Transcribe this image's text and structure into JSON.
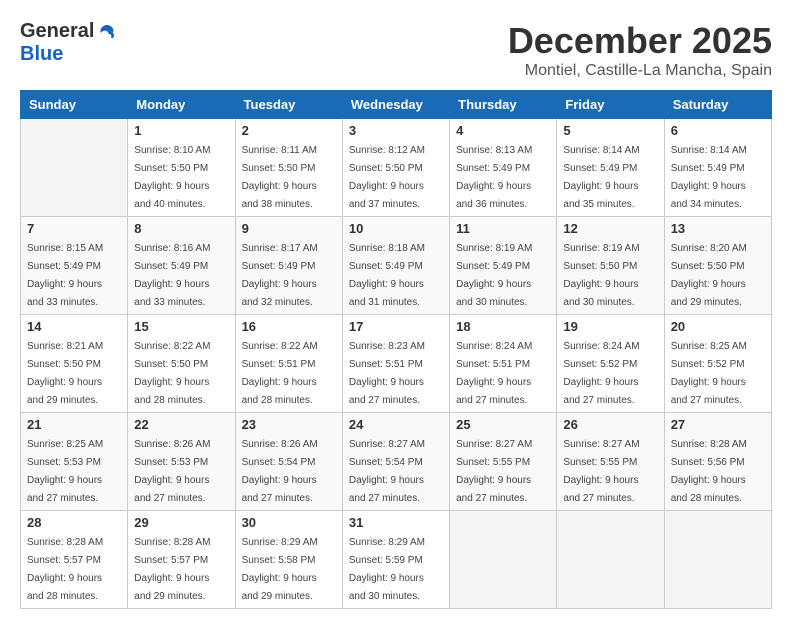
{
  "header": {
    "logo_general": "General",
    "logo_blue": "Blue",
    "month_year": "December 2025",
    "location": "Montiel, Castille-La Mancha, Spain"
  },
  "days_of_week": [
    "Sunday",
    "Monday",
    "Tuesday",
    "Wednesday",
    "Thursday",
    "Friday",
    "Saturday"
  ],
  "weeks": [
    [
      {
        "day": "",
        "sunrise": "",
        "sunset": "",
        "daylight": "",
        "empty": true
      },
      {
        "day": "1",
        "sunrise": "Sunrise: 8:10 AM",
        "sunset": "Sunset: 5:50 PM",
        "daylight": "Daylight: 9 hours and 40 minutes."
      },
      {
        "day": "2",
        "sunrise": "Sunrise: 8:11 AM",
        "sunset": "Sunset: 5:50 PM",
        "daylight": "Daylight: 9 hours and 38 minutes."
      },
      {
        "day": "3",
        "sunrise": "Sunrise: 8:12 AM",
        "sunset": "Sunset: 5:50 PM",
        "daylight": "Daylight: 9 hours and 37 minutes."
      },
      {
        "day": "4",
        "sunrise": "Sunrise: 8:13 AM",
        "sunset": "Sunset: 5:49 PM",
        "daylight": "Daylight: 9 hours and 36 minutes."
      },
      {
        "day": "5",
        "sunrise": "Sunrise: 8:14 AM",
        "sunset": "Sunset: 5:49 PM",
        "daylight": "Daylight: 9 hours and 35 minutes."
      },
      {
        "day": "6",
        "sunrise": "Sunrise: 8:14 AM",
        "sunset": "Sunset: 5:49 PM",
        "daylight": "Daylight: 9 hours and 34 minutes."
      }
    ],
    [
      {
        "day": "7",
        "sunrise": "Sunrise: 8:15 AM",
        "sunset": "Sunset: 5:49 PM",
        "daylight": "Daylight: 9 hours and 33 minutes."
      },
      {
        "day": "8",
        "sunrise": "Sunrise: 8:16 AM",
        "sunset": "Sunset: 5:49 PM",
        "daylight": "Daylight: 9 hours and 33 minutes."
      },
      {
        "day": "9",
        "sunrise": "Sunrise: 8:17 AM",
        "sunset": "Sunset: 5:49 PM",
        "daylight": "Daylight: 9 hours and 32 minutes."
      },
      {
        "day": "10",
        "sunrise": "Sunrise: 8:18 AM",
        "sunset": "Sunset: 5:49 PM",
        "daylight": "Daylight: 9 hours and 31 minutes."
      },
      {
        "day": "11",
        "sunrise": "Sunrise: 8:19 AM",
        "sunset": "Sunset: 5:49 PM",
        "daylight": "Daylight: 9 hours and 30 minutes."
      },
      {
        "day": "12",
        "sunrise": "Sunrise: 8:19 AM",
        "sunset": "Sunset: 5:50 PM",
        "daylight": "Daylight: 9 hours and 30 minutes."
      },
      {
        "day": "13",
        "sunrise": "Sunrise: 8:20 AM",
        "sunset": "Sunset: 5:50 PM",
        "daylight": "Daylight: 9 hours and 29 minutes."
      }
    ],
    [
      {
        "day": "14",
        "sunrise": "Sunrise: 8:21 AM",
        "sunset": "Sunset: 5:50 PM",
        "daylight": "Daylight: 9 hours and 29 minutes."
      },
      {
        "day": "15",
        "sunrise": "Sunrise: 8:22 AM",
        "sunset": "Sunset: 5:50 PM",
        "daylight": "Daylight: 9 hours and 28 minutes."
      },
      {
        "day": "16",
        "sunrise": "Sunrise: 8:22 AM",
        "sunset": "Sunset: 5:51 PM",
        "daylight": "Daylight: 9 hours and 28 minutes."
      },
      {
        "day": "17",
        "sunrise": "Sunrise: 8:23 AM",
        "sunset": "Sunset: 5:51 PM",
        "daylight": "Daylight: 9 hours and 27 minutes."
      },
      {
        "day": "18",
        "sunrise": "Sunrise: 8:24 AM",
        "sunset": "Sunset: 5:51 PM",
        "daylight": "Daylight: 9 hours and 27 minutes."
      },
      {
        "day": "19",
        "sunrise": "Sunrise: 8:24 AM",
        "sunset": "Sunset: 5:52 PM",
        "daylight": "Daylight: 9 hours and 27 minutes."
      },
      {
        "day": "20",
        "sunrise": "Sunrise: 8:25 AM",
        "sunset": "Sunset: 5:52 PM",
        "daylight": "Daylight: 9 hours and 27 minutes."
      }
    ],
    [
      {
        "day": "21",
        "sunrise": "Sunrise: 8:25 AM",
        "sunset": "Sunset: 5:53 PM",
        "daylight": "Daylight: 9 hours and 27 minutes."
      },
      {
        "day": "22",
        "sunrise": "Sunrise: 8:26 AM",
        "sunset": "Sunset: 5:53 PM",
        "daylight": "Daylight: 9 hours and 27 minutes."
      },
      {
        "day": "23",
        "sunrise": "Sunrise: 8:26 AM",
        "sunset": "Sunset: 5:54 PM",
        "daylight": "Daylight: 9 hours and 27 minutes."
      },
      {
        "day": "24",
        "sunrise": "Sunrise: 8:27 AM",
        "sunset": "Sunset: 5:54 PM",
        "daylight": "Daylight: 9 hours and 27 minutes."
      },
      {
        "day": "25",
        "sunrise": "Sunrise: 8:27 AM",
        "sunset": "Sunset: 5:55 PM",
        "daylight": "Daylight: 9 hours and 27 minutes."
      },
      {
        "day": "26",
        "sunrise": "Sunrise: 8:27 AM",
        "sunset": "Sunset: 5:55 PM",
        "daylight": "Daylight: 9 hours and 27 minutes."
      },
      {
        "day": "27",
        "sunrise": "Sunrise: 8:28 AM",
        "sunset": "Sunset: 5:56 PM",
        "daylight": "Daylight: 9 hours and 28 minutes."
      }
    ],
    [
      {
        "day": "28",
        "sunrise": "Sunrise: 8:28 AM",
        "sunset": "Sunset: 5:57 PM",
        "daylight": "Daylight: 9 hours and 28 minutes."
      },
      {
        "day": "29",
        "sunrise": "Sunrise: 8:28 AM",
        "sunset": "Sunset: 5:57 PM",
        "daylight": "Daylight: 9 hours and 29 minutes."
      },
      {
        "day": "30",
        "sunrise": "Sunrise: 8:29 AM",
        "sunset": "Sunset: 5:58 PM",
        "daylight": "Daylight: 9 hours and 29 minutes."
      },
      {
        "day": "31",
        "sunrise": "Sunrise: 8:29 AM",
        "sunset": "Sunset: 5:59 PM",
        "daylight": "Daylight: 9 hours and 30 minutes."
      },
      {
        "day": "",
        "sunrise": "",
        "sunset": "",
        "daylight": "",
        "empty": true
      },
      {
        "day": "",
        "sunrise": "",
        "sunset": "",
        "daylight": "",
        "empty": true
      },
      {
        "day": "",
        "sunrise": "",
        "sunset": "",
        "daylight": "",
        "empty": true
      }
    ]
  ]
}
